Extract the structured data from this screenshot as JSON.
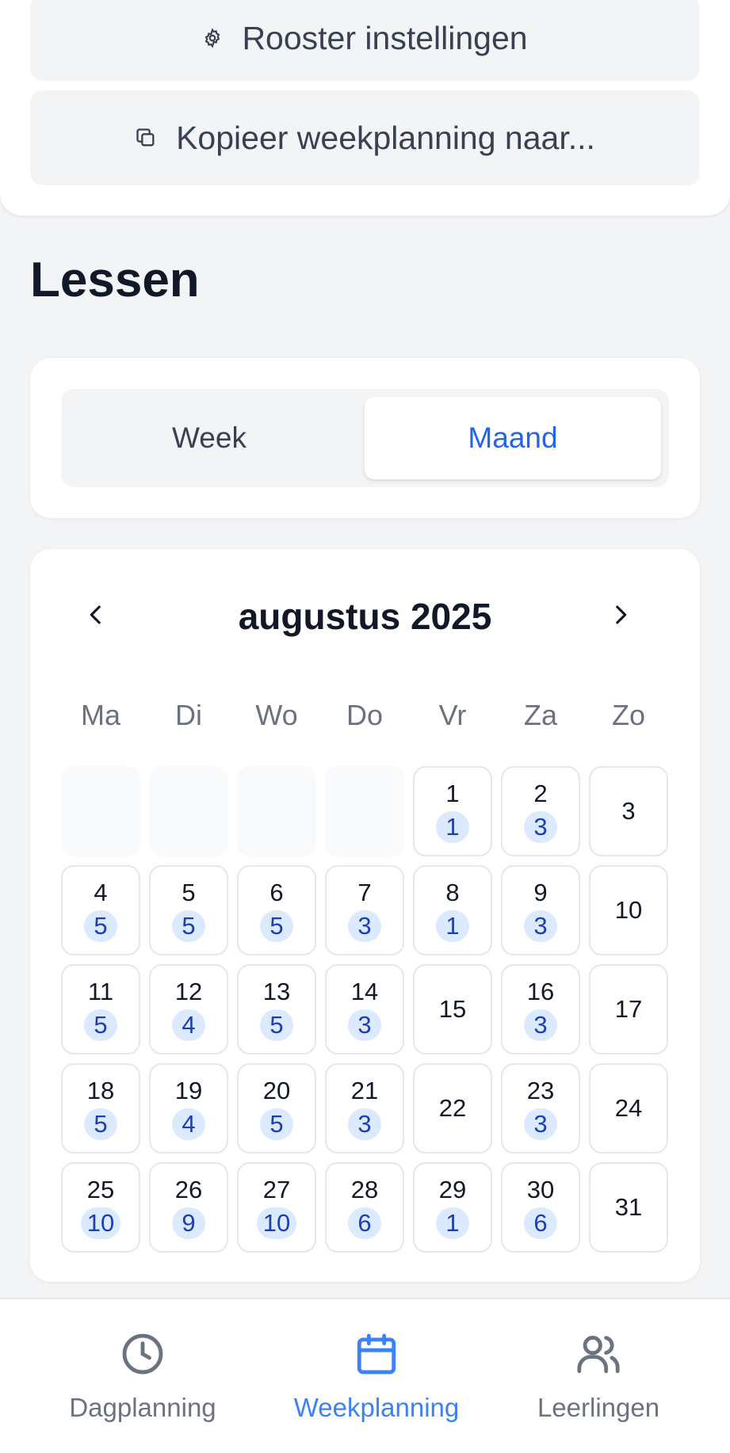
{
  "actions": {
    "settings_label": "Rooster instellingen",
    "copy_label": "Kopieer weekplanning naar..."
  },
  "section_title": "Lessen",
  "view_toggle": {
    "week": "Week",
    "month": "Maand",
    "selected": "Maand"
  },
  "calendar": {
    "month_label": "augustus 2025",
    "weekdays": [
      "Ma",
      "Di",
      "Wo",
      "Do",
      "Vr",
      "Za",
      "Zo"
    ],
    "leading_empty": 4,
    "days": [
      {
        "day": "1",
        "count": "1"
      },
      {
        "day": "2",
        "count": "3"
      },
      {
        "day": "3",
        "count": ""
      },
      {
        "day": "4",
        "count": "5"
      },
      {
        "day": "5",
        "count": "5"
      },
      {
        "day": "6",
        "count": "5"
      },
      {
        "day": "7",
        "count": "3"
      },
      {
        "day": "8",
        "count": "1"
      },
      {
        "day": "9",
        "count": "3"
      },
      {
        "day": "10",
        "count": ""
      },
      {
        "day": "11",
        "count": "5"
      },
      {
        "day": "12",
        "count": "4"
      },
      {
        "day": "13",
        "count": "5"
      },
      {
        "day": "14",
        "count": "3"
      },
      {
        "day": "15",
        "count": ""
      },
      {
        "day": "16",
        "count": "3"
      },
      {
        "day": "17",
        "count": ""
      },
      {
        "day": "18",
        "count": "5"
      },
      {
        "day": "19",
        "count": "4"
      },
      {
        "day": "20",
        "count": "5"
      },
      {
        "day": "21",
        "count": "3"
      },
      {
        "day": "22",
        "count": ""
      },
      {
        "day": "23",
        "count": "3"
      },
      {
        "day": "24",
        "count": ""
      },
      {
        "day": "25",
        "count": "10"
      },
      {
        "day": "26",
        "count": "9"
      },
      {
        "day": "27",
        "count": "10"
      },
      {
        "day": "28",
        "count": "6"
      },
      {
        "day": "29",
        "count": "1"
      },
      {
        "day": "30",
        "count": "6"
      },
      {
        "day": "31",
        "count": ""
      }
    ]
  },
  "bottom_nav": {
    "items": [
      {
        "label": "Dagplanning",
        "icon": "clock-icon",
        "active": false
      },
      {
        "label": "Weekplanning",
        "icon": "calendar-icon",
        "active": true
      },
      {
        "label": "Leerlingen",
        "icon": "users-icon",
        "active": false
      }
    ]
  },
  "colors": {
    "accent": "#2563eb",
    "badge_bg": "#dbeafe",
    "badge_text": "#1e40af",
    "page_bg": "#f3f4f6"
  }
}
